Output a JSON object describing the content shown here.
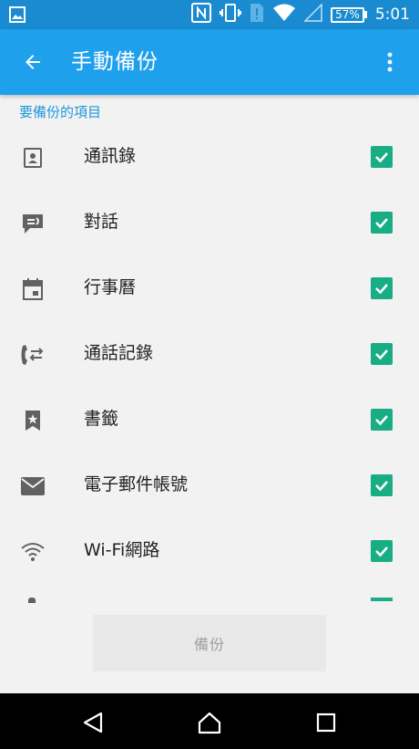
{
  "status_bar": {
    "battery_text": "57%",
    "time": "5:01",
    "icons": [
      "gallery-icon",
      "nfc-icon",
      "vibrate-icon",
      "sim-alert-icon",
      "wifi-icon",
      "cell-signal-icon",
      "battery-icon"
    ]
  },
  "app_bar": {
    "title": "手動備份",
    "back_icon": "arrow-back-icon",
    "menu_icon": "more-vert-icon"
  },
  "section": {
    "header": "要備份的項目"
  },
  "items": [
    {
      "label": "通訊錄",
      "icon": "contact-icon",
      "checked": true
    },
    {
      "label": "對話",
      "icon": "message-icon",
      "checked": true
    },
    {
      "label": "行事曆",
      "icon": "calendar-icon",
      "checked": true
    },
    {
      "label": "通話記錄",
      "icon": "call-log-icon",
      "checked": true
    },
    {
      "label": "書籤",
      "icon": "bookmark-icon",
      "checked": true
    },
    {
      "label": "電子郵件帳號",
      "icon": "email-icon",
      "checked": true
    },
    {
      "label": "Wi-Fi網路",
      "icon": "wifi-icon",
      "checked": true
    }
  ],
  "actions": {
    "backup_label": "備份"
  },
  "colors": {
    "status_bar": "#1a8bd0",
    "app_bar": "#1fa0ec",
    "accent": "#1f97dd",
    "checkbox": "#19ad86"
  }
}
